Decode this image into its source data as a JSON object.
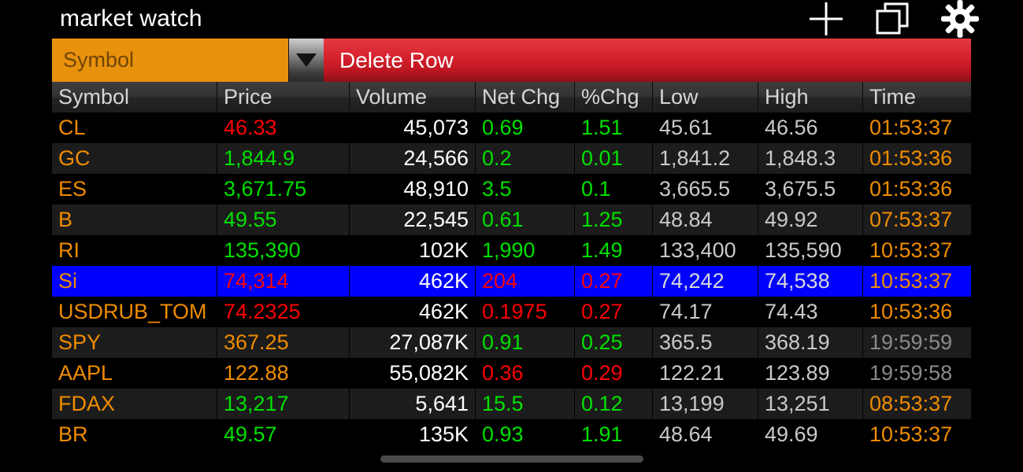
{
  "titlebar": {
    "title": "market watch",
    "actions": [
      {
        "name": "add-icon",
        "glyph": "plus"
      },
      {
        "name": "duplicate-icon",
        "glyph": "copy"
      },
      {
        "name": "settings-icon",
        "glyph": "gear"
      }
    ]
  },
  "entrybar": {
    "symbol_placeholder": "Symbol",
    "symbol_value": "",
    "dropdown_glyph": "chevron-down-icon",
    "delete_label": "Delete Row"
  },
  "table": {
    "columns": [
      "Symbol",
      "Price",
      "Volume",
      "Net Chg",
      "%Chg",
      "Low",
      "High",
      "Time"
    ],
    "rows": [
      {
        "symbol": "CL",
        "price": "46.33",
        "price_state": "down",
        "volume": "45,073",
        "net": "0.69",
        "net_state": "up",
        "pct": "1.51",
        "pct_state": "up",
        "low": "45.61",
        "high": "46.56",
        "time": "01:53:37",
        "time_state": "live",
        "selected": false
      },
      {
        "symbol": "GC",
        "price": "1,844.9",
        "price_state": "up",
        "volume": "24,566",
        "net": "0.2",
        "net_state": "up",
        "pct": "0.01",
        "pct_state": "up",
        "low": "1,841.2",
        "high": "1,848.3",
        "time": "01:53:36",
        "time_state": "live",
        "selected": false
      },
      {
        "symbol": "ES",
        "price": "3,671.75",
        "price_state": "up",
        "volume": "48,910",
        "net": "3.5",
        "net_state": "up",
        "pct": "0.1",
        "pct_state": "up",
        "low": "3,665.5",
        "high": "3,675.5",
        "time": "01:53:36",
        "time_state": "live",
        "selected": false
      },
      {
        "symbol": "B",
        "price": "49.55",
        "price_state": "up",
        "volume": "22,545",
        "net": "0.61",
        "net_state": "up",
        "pct": "1.25",
        "pct_state": "up",
        "low": "48.84",
        "high": "49.92",
        "time": "07:53:37",
        "time_state": "live",
        "selected": false
      },
      {
        "symbol": "RI",
        "price": "135,390",
        "price_state": "up",
        "volume": "102K",
        "net": "1,990",
        "net_state": "up",
        "pct": "1.49",
        "pct_state": "up",
        "low": "133,400",
        "high": "135,590",
        "time": "10:53:37",
        "time_state": "live",
        "selected": false
      },
      {
        "symbol": "Si",
        "price": "74,314",
        "price_state": "down",
        "volume": "462K",
        "net": "204",
        "net_state": "down",
        "pct": "0.27",
        "pct_state": "down",
        "low": "74,242",
        "high": "74,538",
        "time": "10:53:37",
        "time_state": "live",
        "selected": true
      },
      {
        "symbol": "USDRUB_TOM",
        "price": "74.2325",
        "price_state": "down",
        "volume": "462K",
        "net": "0.1975",
        "net_state": "down",
        "pct": "0.27",
        "pct_state": "down",
        "low": "74.17",
        "high": "74.43",
        "time": "10:53:36",
        "time_state": "live",
        "selected": false
      },
      {
        "symbol": "SPY",
        "price": "367.25",
        "price_state": "flat",
        "volume": "27,087K",
        "net": "0.91",
        "net_state": "up",
        "pct": "0.25",
        "pct_state": "up",
        "low": "365.5",
        "high": "368.19",
        "time": "19:59:59",
        "time_state": "stale",
        "selected": false
      },
      {
        "symbol": "AAPL",
        "price": "122.88",
        "price_state": "flat",
        "volume": "55,082K",
        "net": "0.36",
        "net_state": "down",
        "pct": "0.29",
        "pct_state": "down",
        "low": "122.21",
        "high": "123.89",
        "time": "19:59:58",
        "time_state": "stale",
        "selected": false
      },
      {
        "symbol": "FDAX",
        "price": "13,217",
        "price_state": "up",
        "volume": "5,641",
        "net": "15.5",
        "net_state": "up",
        "pct": "0.12",
        "pct_state": "up",
        "low": "13,199",
        "high": "13,251",
        "time": "08:53:37",
        "time_state": "live",
        "selected": false
      },
      {
        "symbol": "BR",
        "price": "49.57",
        "price_state": "up",
        "volume": "135K",
        "net": "0.93",
        "net_state": "up",
        "pct": "1.91",
        "pct_state": "up",
        "low": "48.64",
        "high": "49.69",
        "time": "10:53:37",
        "time_state": "live",
        "selected": false
      }
    ]
  },
  "scrollbar": {
    "name": "horizontal-scrollbar"
  },
  "colors": {
    "accent_orange": "#f08c00",
    "field_orange": "#e8910c",
    "delete_red": "#d8232f",
    "up_green": "#00e000",
    "down_red": "#fb0007",
    "selected_blue": "#0000ff",
    "header_gray": "#343434",
    "stale_gray": "#8a8a8a"
  }
}
